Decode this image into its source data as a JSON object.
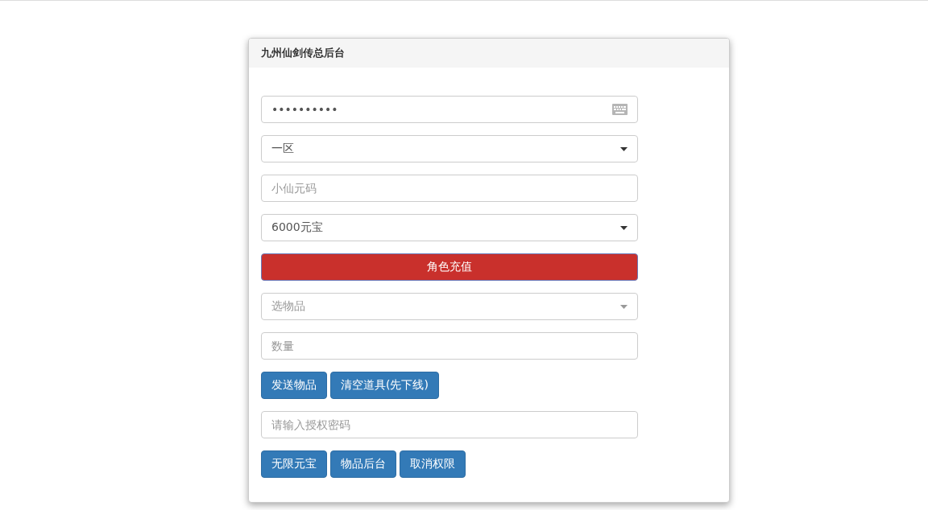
{
  "panel": {
    "title": "九州仙剑传总后台"
  },
  "rows": [
    {
      "kind": "password",
      "value": "••••••••••"
    },
    {
      "kind": "select",
      "value": "一区"
    },
    {
      "kind": "input",
      "placeholder": "小仙元码"
    },
    {
      "kind": "select",
      "value": "6000元宝"
    },
    {
      "kind": "wide-button",
      "label": "角色充值"
    },
    {
      "kind": "select",
      "placeholder": "选物品"
    },
    {
      "kind": "input",
      "placeholder": "数量"
    },
    {
      "kind": "buttons",
      "labels": [
        "发送物品",
        "清空道具(先下线)"
      ]
    },
    {
      "kind": "input",
      "placeholder": "请输入授权密码"
    },
    {
      "kind": "buttons",
      "labels": [
        "无限元宝",
        "物品后台",
        "取消权限"
      ]
    }
  ]
}
